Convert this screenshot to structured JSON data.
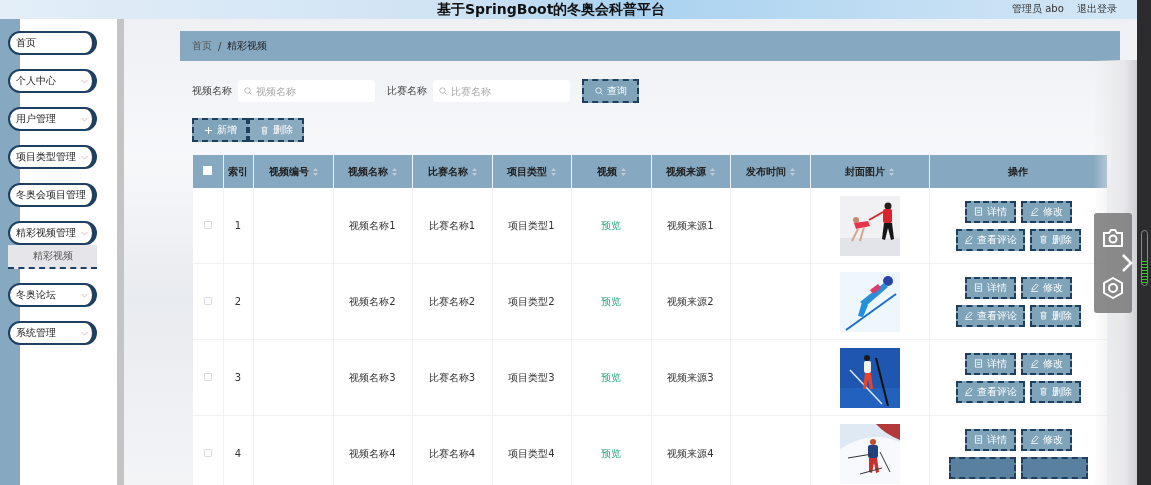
{
  "header": {
    "title": "基于SpringBoot的冬奥会科普平台",
    "user": "管理员 abo",
    "logout": "退出登录"
  },
  "sidebar": {
    "items": [
      {
        "label": "首页",
        "kind": "link",
        "expanded": false
      },
      {
        "label": "个人中心",
        "kind": "menu",
        "expanded": false
      },
      {
        "label": "用户管理",
        "kind": "menu",
        "expanded": false
      },
      {
        "label": "项目类型管理",
        "kind": "menu",
        "expanded": false
      },
      {
        "label": "冬奥会项目管理",
        "kind": "menu",
        "expanded": false
      },
      {
        "label": "精彩视频管理",
        "kind": "menu",
        "expanded": true,
        "children": [
          {
            "label": "精彩视频",
            "selected": true
          }
        ]
      },
      {
        "label": "冬奥论坛",
        "kind": "menu",
        "expanded": false
      },
      {
        "label": "系统管理",
        "kind": "menu",
        "expanded": false
      }
    ]
  },
  "breadcrumb": {
    "items": [
      "首页",
      "精彩视频"
    ],
    "separator": "/"
  },
  "search": {
    "fields": [
      {
        "label": "视频名称",
        "placeholder": "视频名称"
      },
      {
        "label": "比赛名称",
        "placeholder": "比赛名称"
      }
    ],
    "button": "查询"
  },
  "actions": [
    {
      "label": "新增",
      "kind": "add"
    },
    {
      "label": "删除",
      "kind": "delete"
    }
  ],
  "table": {
    "select_all": {
      "checked": false
    },
    "columns": [
      {
        "label": "索引",
        "sortable": false
      },
      {
        "label": "视频编号",
        "sortable": true
      },
      {
        "label": "视频名称",
        "sortable": true
      },
      {
        "label": "比赛名称",
        "sortable": true
      },
      {
        "label": "项目类型",
        "sortable": true
      },
      {
        "label": "视频",
        "sortable": true
      },
      {
        "label": "视频来源",
        "sortable": true
      },
      {
        "label": "发布时间",
        "sortable": true
      },
      {
        "label": "封面图片",
        "sortable": true
      },
      {
        "label": "操作",
        "sortable": false
      }
    ],
    "rows": [
      {
        "checked": false,
        "index": "1",
        "video_name": "视频名称1",
        "match_name": "比赛名称1",
        "type": "项目类型1",
        "video": "预览",
        "source": "视频来源1",
        "buttons": [
          {
            "label": "详情",
            "kind": "detail"
          },
          {
            "label": "修改",
            "kind": "edit"
          },
          {
            "label": "查看评论",
            "kind": "comments"
          },
          {
            "label": "删除",
            "kind": "delete"
          }
        ]
      },
      {
        "checked": false,
        "index": "2",
        "video_name": "视频名称2",
        "match_name": "比赛名称2",
        "type": "项目类型2",
        "video": "预览",
        "source": "视频来源2",
        "buttons": [
          {
            "label": "详情",
            "kind": "detail"
          },
          {
            "label": "修改",
            "kind": "edit"
          },
          {
            "label": "查看评论",
            "kind": "comments"
          },
          {
            "label": "删除",
            "kind": "delete"
          }
        ]
      },
      {
        "checked": false,
        "index": "3",
        "video_name": "视频名称3",
        "match_name": "比赛名称3",
        "type": "项目类型3",
        "video": "预览",
        "source": "视频来源3",
        "buttons": [
          {
            "label": "详情",
            "kind": "detail"
          },
          {
            "label": "修改",
            "kind": "edit"
          },
          {
            "label": "查看评论",
            "kind": "comments"
          },
          {
            "label": "删除",
            "kind": "delete"
          }
        ]
      },
      {
        "checked": false,
        "index": "4",
        "video_name": "视频名称4",
        "match_name": "比赛名称4",
        "type": "项目类型4",
        "video": "预览",
        "source": "视频来源4",
        "buttons": [
          {
            "label": "详情",
            "kind": "detail"
          },
          {
            "label": "修改",
            "kind": "edit"
          },
          {
            "kind": "comments"
          },
          {
            "kind": "delete"
          }
        ]
      }
    ]
  }
}
